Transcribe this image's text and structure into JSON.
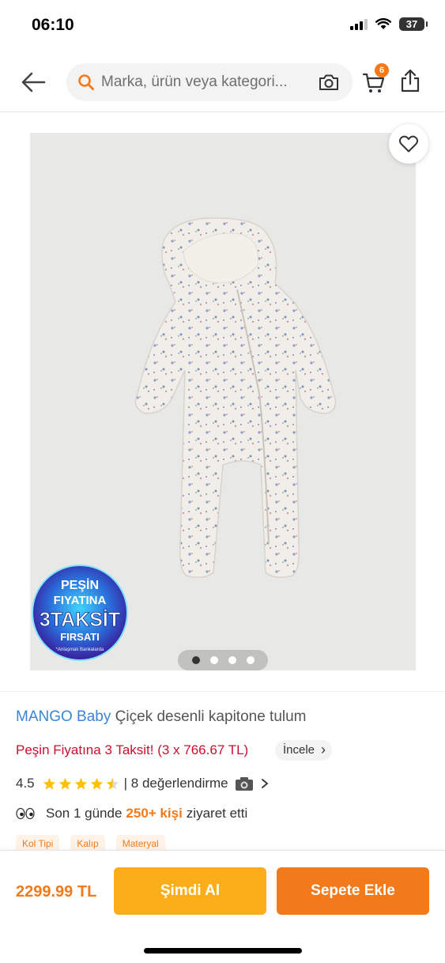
{
  "status_bar": {
    "time": "06:10",
    "battery": "37"
  },
  "nav": {
    "search_placeholder": "Marka, ürün veya kategori...",
    "cart_count": "6"
  },
  "gallery": {
    "image_description_icon": "product-image",
    "dot_count": 4,
    "active_dot": 0,
    "promo_badge": {
      "line1": "PEŞİN",
      "line2": "FIYATINA",
      "line3": "3TAKSİT",
      "line4": "FIRSATI",
      "footnote": "*Anlaşmalı Bankalarda"
    }
  },
  "product": {
    "brand": "MANGO Baby",
    "name": "Çiçek desenli kapitone tulum",
    "taksit_text": "Peşin Fiyatına 3 Taksit! (3 x 766.67 TL)",
    "incele_label": "İncele",
    "rating": "4.5",
    "rating_value": 4.5,
    "reviews_text": "| 8 değerlendirme",
    "visit_prefix": "Son 1 günde",
    "visit_highlight": "250+ kişi",
    "visit_suffix": "ziyaret etti",
    "chips": [
      "Kol Tipi",
      "Kalıp",
      "Materyal"
    ]
  },
  "bottom_bar": {
    "price": "2299.99 TL",
    "buy_now_label": "Şimdi Al",
    "add_to_cart_label": "Sepete Ekle"
  },
  "colors": {
    "accent": "#f27a1a",
    "buy_now": "#fbae1a",
    "brand_link": "#3a85d4",
    "taksit_red": "#c8102e"
  }
}
